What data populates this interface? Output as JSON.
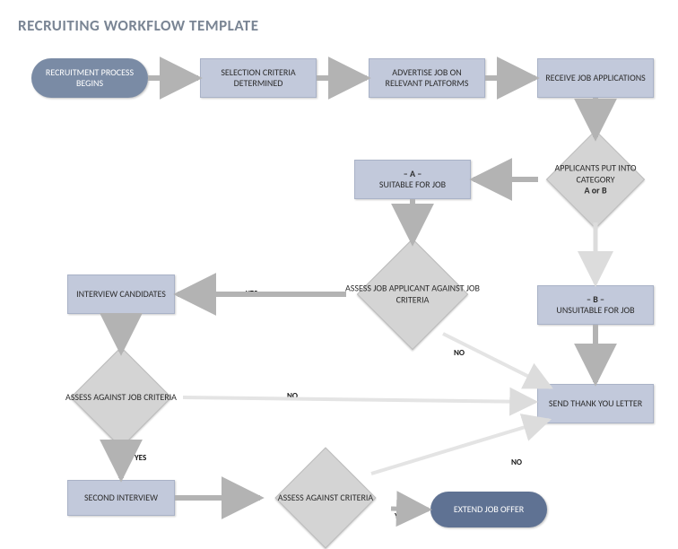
{
  "title": "RECRUITING WORKFLOW TEMPLATE",
  "nodes": {
    "start": "RECRUITMENT PROCESS BEGINS",
    "selection": "SELECTION CRITERIA DETERMINED",
    "advertise": "ADVERTISE JOB ON RELEVANT PLATFORMS",
    "receive": "RECEIVE JOB APPLICATIONS",
    "categorise": "APPLICANTS PUT INTO CATEGORY",
    "categorise_sub": "A or B",
    "cat_a_header": "– A –",
    "cat_a": "SUITABLE FOR JOB",
    "cat_b_header": "– B –",
    "cat_b": "UNSUITABLE FOR JOB",
    "assess1": "ASSESS JOB APPLICANT AGAINST JOB CRITERIA",
    "interview": "INTERVIEW CANDIDATES",
    "assess2": "ASSESS AGAINST JOB CRITERIA",
    "second_interview": "SECOND INTERVIEW",
    "assess3": "ASSESS AGAINST CRITERIA",
    "thankyou": "SEND THANK YOU LETTER",
    "offer": "EXTEND JOB OFFER"
  },
  "labels": {
    "yes": "YES",
    "no": "NO"
  },
  "colors": {
    "header": "#7a8594",
    "start_bg": "#7a8ba5",
    "end_bg": "#5f7293",
    "proc_bg": "#c2c9db",
    "diamond_bg": "#d4d4d4"
  },
  "chart_data": {
    "type": "diagram",
    "title": "RECRUITING WORKFLOW TEMPLATE",
    "nodes": [
      {
        "id": "start",
        "type": "terminator",
        "text": "RECRUITMENT PROCESS BEGINS"
      },
      {
        "id": "selection",
        "type": "process",
        "text": "SELECTION CRITERIA DETERMINED"
      },
      {
        "id": "advertise",
        "type": "process",
        "text": "ADVERTISE JOB ON RELEVANT PLATFORMS"
      },
      {
        "id": "receive",
        "type": "process",
        "text": "RECEIVE JOB APPLICATIONS"
      },
      {
        "id": "categorise",
        "type": "decision",
        "text": "APPLICANTS PUT INTO CATEGORY A or B"
      },
      {
        "id": "cat_a",
        "type": "process",
        "text": "– A – SUITABLE FOR JOB"
      },
      {
        "id": "cat_b",
        "type": "process",
        "text": "– B – UNSUITABLE FOR JOB"
      },
      {
        "id": "assess1",
        "type": "decision",
        "text": "ASSESS JOB APPLICANT AGAINST JOB CRITERIA"
      },
      {
        "id": "interview",
        "type": "process",
        "text": "INTERVIEW CANDIDATES"
      },
      {
        "id": "assess2",
        "type": "decision",
        "text": "ASSESS AGAINST JOB CRITERIA"
      },
      {
        "id": "second_interview",
        "type": "process",
        "text": "SECOND INTERVIEW"
      },
      {
        "id": "assess3",
        "type": "decision",
        "text": "ASSESS AGAINST CRITERIA"
      },
      {
        "id": "thankyou",
        "type": "process",
        "text": "SEND THANK YOU LETTER"
      },
      {
        "id": "offer",
        "type": "terminator",
        "text": "EXTEND JOB OFFER"
      }
    ],
    "edges": [
      {
        "from": "start",
        "to": "selection"
      },
      {
        "from": "selection",
        "to": "advertise"
      },
      {
        "from": "advertise",
        "to": "receive"
      },
      {
        "from": "receive",
        "to": "categorise"
      },
      {
        "from": "categorise",
        "to": "cat_a"
      },
      {
        "from": "categorise",
        "to": "cat_b"
      },
      {
        "from": "cat_a",
        "to": "assess1"
      },
      {
        "from": "assess1",
        "to": "interview",
        "label": "YES"
      },
      {
        "from": "assess1",
        "to": "thankyou",
        "label": "NO"
      },
      {
        "from": "interview",
        "to": "assess2"
      },
      {
        "from": "assess2",
        "to": "second_interview",
        "label": "YES"
      },
      {
        "from": "assess2",
        "to": "thankyou",
        "label": "NO"
      },
      {
        "from": "second_interview",
        "to": "assess3"
      },
      {
        "from": "assess3",
        "to": "offer",
        "label": "YES"
      },
      {
        "from": "assess3",
        "to": "thankyou",
        "label": "NO"
      },
      {
        "from": "cat_b",
        "to": "thankyou"
      }
    ]
  }
}
